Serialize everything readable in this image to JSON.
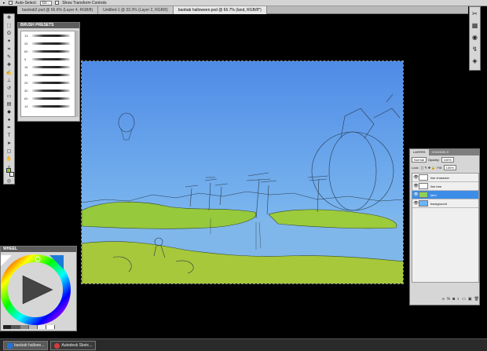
{
  "options_bar": {
    "auto_select_label": "Auto-Select:",
    "auto_select_value": "Gr...",
    "show_transform_label": "Show Transform Controls"
  },
  "doc_tabs": [
    {
      "label": "baobab2.psd @ 66.6% (Layer 4, RGB/8)",
      "active": false
    },
    {
      "label": "Untitled-1 @ 33.3% (Layer 2, RGB/8)",
      "active": false
    },
    {
      "label": "baobab halloween.psd @ 66.7% (land, RGB/8*)",
      "active": true
    }
  ],
  "brush_presets": {
    "title": "BRUSH PRESETS",
    "brushes": [
      "13",
      "25",
      "60",
      "9",
      "16",
      "35",
      "25",
      "30",
      "60",
      "14"
    ]
  },
  "layers": {
    "tabs": [
      "LAYERS",
      "CHANNELS"
    ],
    "blend_mode": "Normal",
    "opacity_label": "Opacity:",
    "opacity_value": "100%",
    "lock_label": "Lock:",
    "fill_label": "Fill:",
    "fill_value": "100%",
    "items": [
      {
        "name": "line character",
        "selected": false,
        "thumb_color": "#ffffff"
      },
      {
        "name": "line tree",
        "selected": false,
        "thumb_color": "#ffffff"
      },
      {
        "name": "land",
        "selected": true,
        "thumb_color": "#8fd05a"
      },
      {
        "name": "background",
        "selected": false,
        "thumb_color": "#6ab4ff"
      }
    ]
  },
  "colors_panel": {
    "title": "WHEEL"
  },
  "taskbar": [
    {
      "label": "baobab halloee...",
      "active": true,
      "icon_color": "#1e73d8"
    },
    {
      "label": "Autodesk Sketc...",
      "active": false,
      "icon_color": "#d23c3c"
    }
  ],
  "colors": {
    "sky_top": "#4f8be6",
    "sky_bottom": "#8ec9f2",
    "land": "#96c93c",
    "water": "#7fb7ea",
    "foreground": "#a6c83a"
  }
}
